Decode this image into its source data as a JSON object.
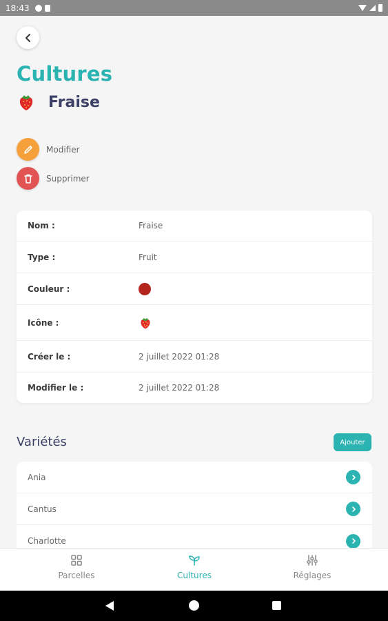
{
  "status_bar": {
    "time": "18:43"
  },
  "header": {
    "title": "Cultures",
    "crop_name": "Fraise",
    "crop_icon": "strawberry-icon"
  },
  "actions": {
    "edit_label": "Modifier",
    "delete_label": "Supprimer"
  },
  "details": {
    "rows": [
      {
        "label": "Nom :",
        "value": "Fraise"
      },
      {
        "label": "Type :",
        "value": "Fruit"
      },
      {
        "label": "Couleur :",
        "value": "",
        "color": "#b3261e"
      },
      {
        "label": "Icône :",
        "value": "",
        "icon": "strawberry-icon"
      },
      {
        "label": "Créer le :",
        "value": "2 juillet 2022 01:28"
      },
      {
        "label": "Modifier le :",
        "value": "2 juillet 2022 01:28"
      }
    ]
  },
  "varieties": {
    "title": "Variétés",
    "add_label": "Ajouter",
    "items": [
      "Ania",
      "Cantus",
      "Charlotte"
    ]
  },
  "tabbar": {
    "tabs": [
      {
        "label": "Parcelles",
        "icon": "grid-icon",
        "active": false
      },
      {
        "label": "Cultures",
        "icon": "sprout-icon",
        "active": true
      },
      {
        "label": "Réglages",
        "icon": "sliders-icon",
        "active": false
      }
    ]
  },
  "colors": {
    "accent": "#2bb3b1",
    "edit": "#f5a03a",
    "delete": "#e25454",
    "heading": "#3c3f66"
  }
}
